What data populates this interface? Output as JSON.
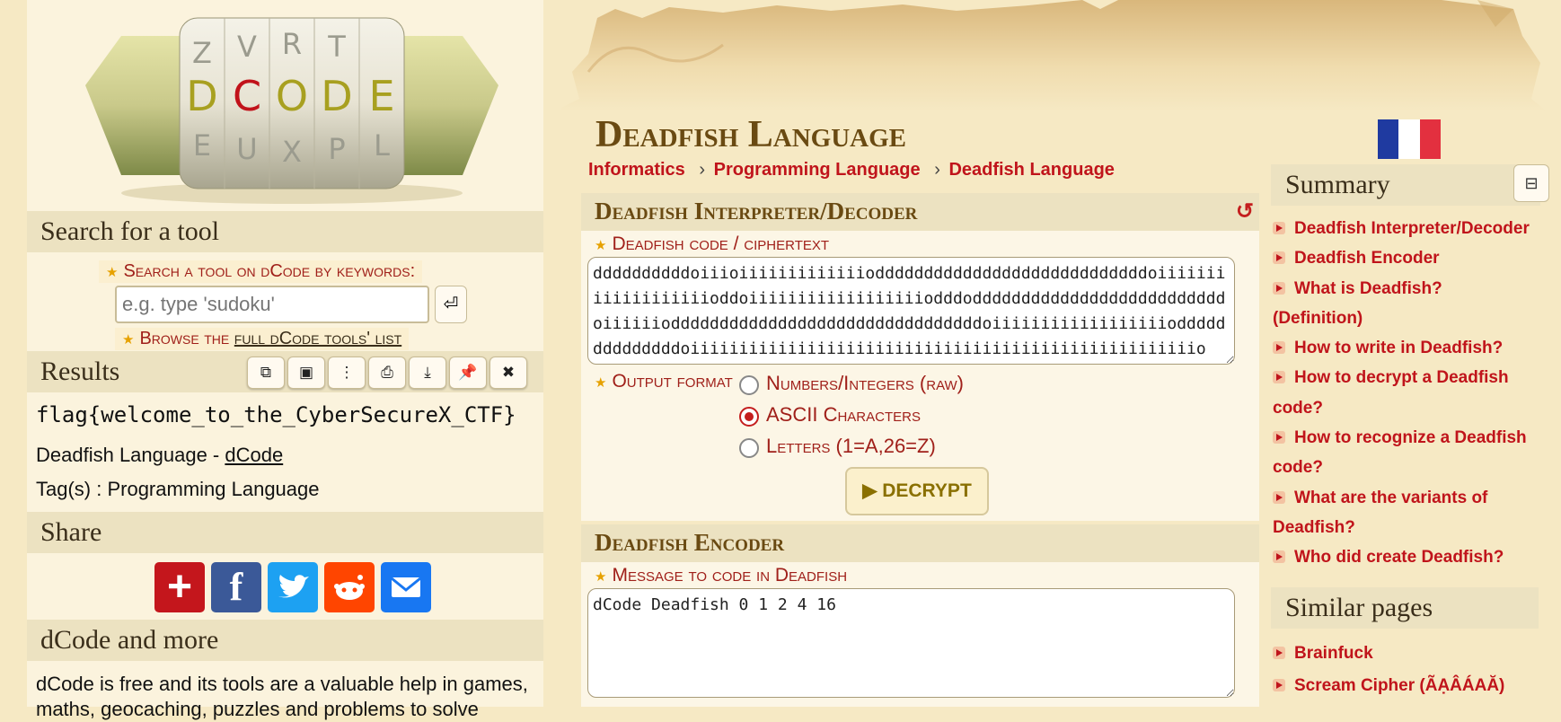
{
  "logo": {
    "letters": [
      "D",
      "C",
      "O",
      "D",
      "E"
    ],
    "top_letters": [
      "Z",
      "V",
      "R",
      "T"
    ],
    "bottom_letters": [
      "E",
      "U",
      "X",
      "P",
      "L"
    ]
  },
  "search": {
    "heading": "Search for a tool",
    "label": "Search a tool on dCode by keywords:",
    "placeholder": "e.g. type 'sudoku'",
    "go_icon": "⏎",
    "browse_prefix": "Browse the ",
    "browse_link": "full dCode tools' list"
  },
  "results": {
    "heading": "Results",
    "toolbar_icons": [
      "copy-icon",
      "screenshot-icon",
      "split-icon",
      "print-icon",
      "download-icon",
      "pin-icon",
      "close-icon"
    ],
    "flag": "flag{welcome_to_the_CyberSecureX_CTF}",
    "source_prefix": "Deadfish Language - ",
    "source_link": "dCode",
    "tags": "Tag(s) : Programming Language"
  },
  "share": {
    "heading": "Share",
    "colors": [
      "#c4161c",
      "#3b5998",
      "#1da1f2",
      "#ff4500",
      "#1877f2"
    ]
  },
  "more": {
    "heading": "dCode and more",
    "text": "dCode is free and its tools are a valuable help in games, maths, geocaching, puzzles and problems to solve"
  },
  "page": {
    "title": "Deadfish Language",
    "breadcrumb": [
      "Informatics",
      "Programming Language",
      "Deadfish Language"
    ],
    "separator": "›"
  },
  "decoder": {
    "heading": "Deadfish Interpreter/Decoder",
    "refresh_icon": "↺",
    "code_label": "Deadfish code / ciphertext",
    "code_value": "ddddddddddoiiioiiiiiiiiiiiiioddddddddddddddddddddddddddddoiiiiiiiiiiiiiiiiiiioddoiiiiiiiiiiiiiiiiiiodddoddddddddddddddddddddddddddoiiiiiioddddddddddddddddddddddddddddddddoiiiiiiiiiiiiiiiiiioddddddddddddddoiiiiiiiiiiiiiiiiiiiiiiiiiiiiiiiiiiiiiiiiiiiiiiiiiiiio",
    "output_label": "Output format",
    "options": [
      "Numbers/Integers (raw)",
      "ASCII Characters",
      "Letters (1=A,26=Z)"
    ],
    "selected": 1,
    "button": "▶ DECRYPT"
  },
  "encoder": {
    "heading": "Deadfish Encoder",
    "message_label": "Message to code in Deadfish",
    "message_value": "dCode Deadfish 0 1 2 4 16"
  },
  "summary": {
    "heading": "Summary",
    "collapse_icon": "⊟",
    "items": [
      "Deadfish Interpreter/Decoder",
      "Deadfish Encoder",
      "What is Deadfish? (Definition)",
      "How to write in Deadfish?",
      "How to decrypt a Deadfish code?",
      "How to recognize a Deadfish code?",
      "What are the variants of Deadfish?",
      "Who did create Deadfish?"
    ]
  },
  "similar": {
    "heading": "Similar pages",
    "items": [
      "Brainfuck",
      "Scream Cipher (ÃẠÂÁAĂ)"
    ]
  }
}
